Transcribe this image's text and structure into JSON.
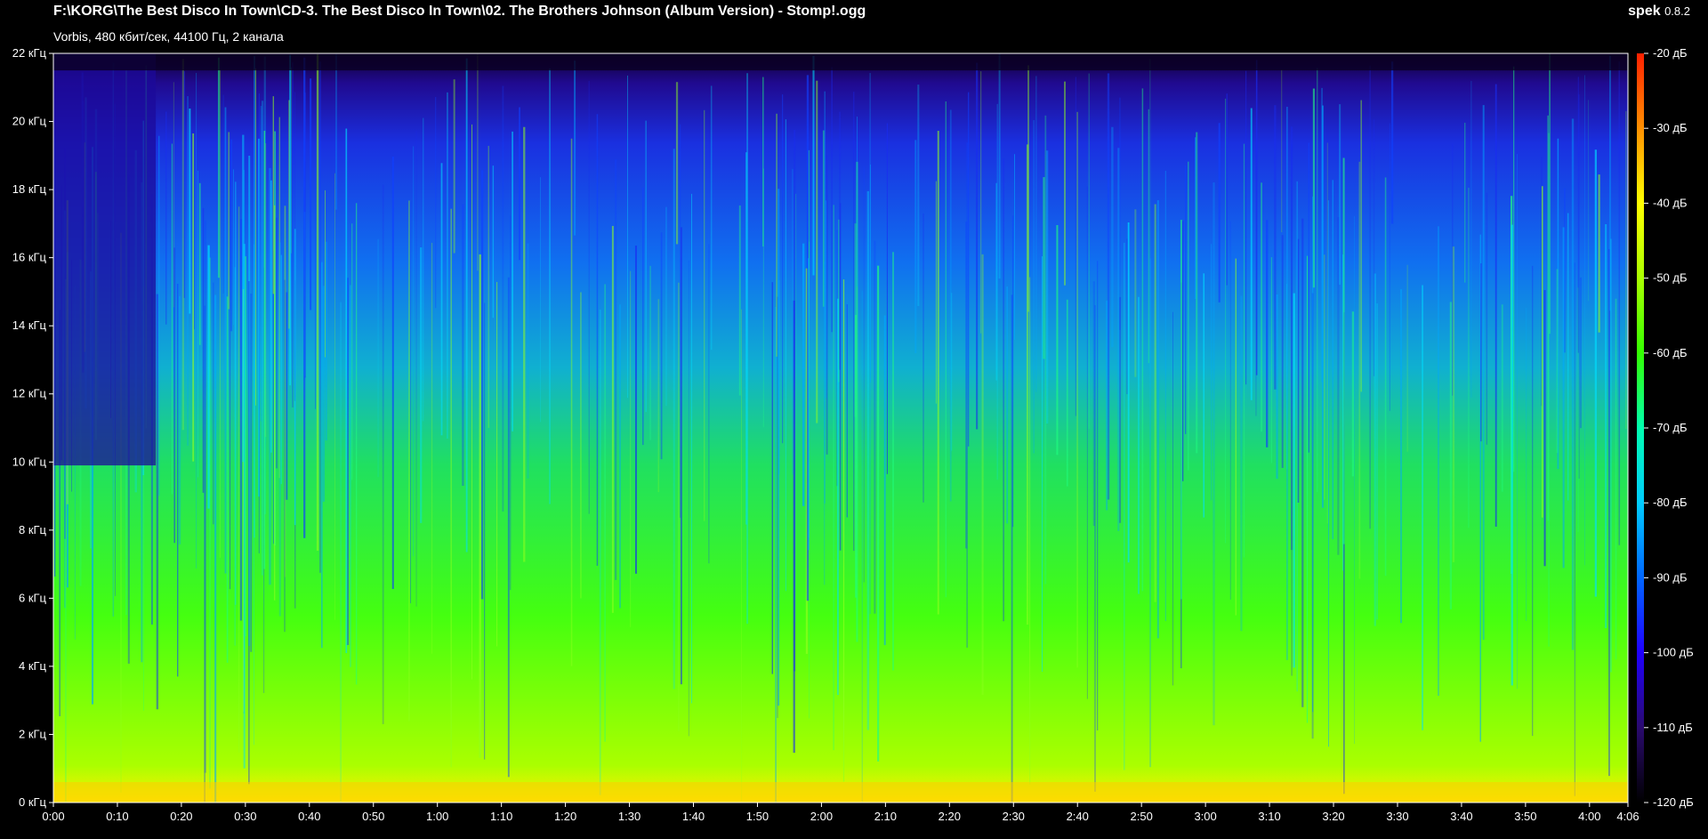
{
  "header": {
    "file_path": "F:\\KORG\\The Best Disco In Town\\CD-3. The Best Disco In Town\\02. The Brothers Johnson (Album Version) - Stomp!.ogg",
    "file_info": "Vorbis, 480 кбит/сек, 44100 Гц, 2 канала",
    "app_name": "spek",
    "app_version": "0.8.2"
  },
  "chart_data": {
    "type": "heatmap",
    "title": "",
    "x_axis": {
      "unit": "time",
      "range": [
        "0:00",
        "4:06"
      ],
      "tick_labels": [
        "0:00",
        "0:10",
        "0:20",
        "0:30",
        "0:40",
        "0:50",
        "1:00",
        "1:10",
        "1:20",
        "1:30",
        "1:40",
        "1:50",
        "2:00",
        "2:10",
        "2:20",
        "2:30",
        "2:40",
        "2:50",
        "3:00",
        "3:10",
        "3:20",
        "3:30",
        "3:40",
        "3:50",
        "4:00",
        "4:06"
      ],
      "tick_seconds": [
        0,
        10,
        20,
        30,
        40,
        50,
        60,
        70,
        80,
        90,
        100,
        110,
        120,
        130,
        140,
        150,
        160,
        170,
        180,
        190,
        200,
        210,
        220,
        230,
        240,
        246
      ]
    },
    "y_axis": {
      "unit": "kHz",
      "range": [
        0,
        22
      ],
      "tick_values": [
        0,
        2,
        4,
        6,
        8,
        10,
        12,
        14,
        16,
        18,
        20,
        22
      ],
      "tick_labels": [
        "0 кГц",
        "2 кГц",
        "4 кГц",
        "6 кГц",
        "8 кГц",
        "10 кГц",
        "12 кГц",
        "14 кГц",
        "16 кГц",
        "18 кГц",
        "20 кГц",
        "22 кГц"
      ]
    },
    "color_scale": {
      "range_db": [
        -120,
        -20
      ],
      "tick_values": [
        -20,
        -30,
        -40,
        -50,
        -60,
        -70,
        -80,
        -90,
        -100,
        -110,
        -120
      ],
      "tick_labels": [
        "-20 дБ",
        "-30 дБ",
        "-40 дБ",
        "-50 дБ",
        "-60 дБ",
        "-70 дБ",
        "-80 дБ",
        "-90 дБ",
        "-100 дБ",
        "-110 дБ",
        "-120 дБ"
      ],
      "colors": [
        "#000000",
        "#2a0a6e",
        "#2000ff",
        "#0066ff",
        "#00ccff",
        "#00ffb0",
        "#33ff00",
        "#aaff00",
        "#ffff00",
        "#ff9000",
        "#ff2000"
      ]
    },
    "grid": false,
    "legend_placement": "right"
  }
}
